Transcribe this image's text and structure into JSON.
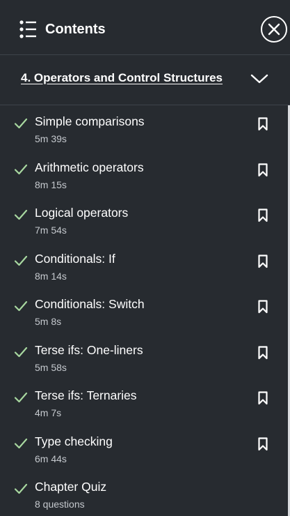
{
  "header": {
    "title": "Contents",
    "icon": "list-icon",
    "close_icon": "close-icon"
  },
  "section": {
    "title": "4. Operators and Control Structures",
    "chevron_icon": "chevron-down-icon",
    "expanded": true
  },
  "items": [
    {
      "title": "Simple comparisons",
      "meta": "5m 39s",
      "completed": true,
      "bookmarkable": true
    },
    {
      "title": "Arithmetic operators",
      "meta": "8m 15s",
      "completed": true,
      "bookmarkable": true
    },
    {
      "title": "Logical operators",
      "meta": "7m 54s",
      "completed": true,
      "bookmarkable": true
    },
    {
      "title": "Conditionals: If",
      "meta": "8m 14s",
      "completed": true,
      "bookmarkable": true
    },
    {
      "title": "Conditionals: Switch",
      "meta": "5m 8s",
      "completed": true,
      "bookmarkable": true
    },
    {
      "title": "Terse ifs: One-liners",
      "meta": "5m 58s",
      "completed": true,
      "bookmarkable": true
    },
    {
      "title": "Terse ifs: Ternaries",
      "meta": "4m 7s",
      "completed": true,
      "bookmarkable": true
    },
    {
      "title": "Type checking",
      "meta": "6m 44s",
      "completed": true,
      "bookmarkable": true
    },
    {
      "title": "Chapter Quiz",
      "meta": "8 questions",
      "completed": true,
      "bookmarkable": false
    }
  ],
  "colors": {
    "background": "#272b30",
    "divider": "#3e434a",
    "check": "#a8d8a0",
    "text": "#ffffff",
    "meta_text": "#c5c9ce"
  }
}
